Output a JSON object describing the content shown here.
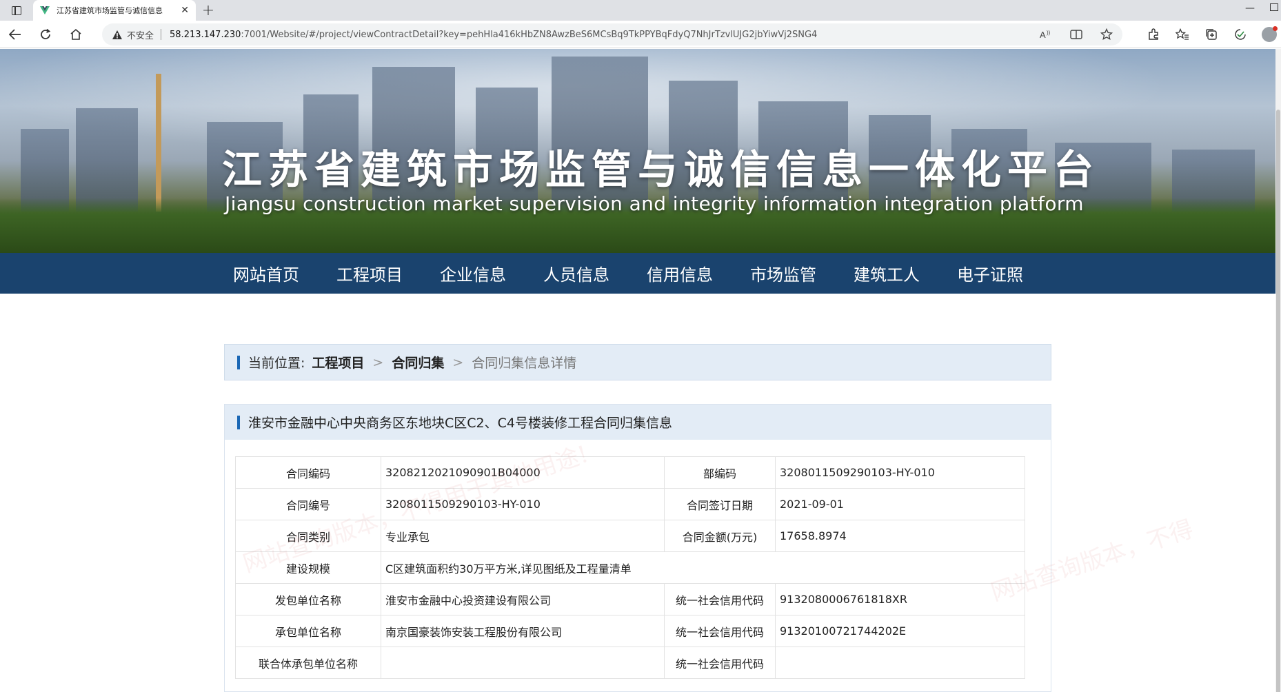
{
  "browser": {
    "tab_title": "江苏省建筑市场监管与诚信信息",
    "insecure_label": "不安全",
    "url_host": "58.213.147.230",
    "url_rest": ":7001/Website/#/project/viewContractDetail?key=pehHla416kHbZN8AwzBeS6MCsBq9TkPPYBqFdyQ7NhJrTzvlUJG2jbYiwVj2SNG4"
  },
  "banner": {
    "title": "江苏省建筑市场监管与诚信信息一体化平台",
    "subtitle": "Jiangsu construction market supervision and integrity information integration platform"
  },
  "nav": {
    "items": [
      {
        "label": "网站首页"
      },
      {
        "label": "工程项目"
      },
      {
        "label": "企业信息"
      },
      {
        "label": "人员信息"
      },
      {
        "label": "信用信息"
      },
      {
        "label": "市场监管"
      },
      {
        "label": "建筑工人"
      },
      {
        "label": "电子证照"
      }
    ]
  },
  "breadcrumb": {
    "label": "当前位置:",
    "level1": "工程项目",
    "sep": ">",
    "level2": "合同归集",
    "current": "合同归集信息详情"
  },
  "card": {
    "title": "淮安市金融中心中央商务区东地块C区C2、C4号楼装修工程合同归集信息"
  },
  "contract": {
    "rows": [
      {
        "l1": "合同编码",
        "v1": "3208212021090901B04000",
        "l2": "部编码",
        "v2": "3208011509290103-HY-010"
      },
      {
        "l1": "合同编号",
        "v1": "3208011509290103-HY-010",
        "l2": "合同签订日期",
        "v2": "2021-09-01"
      },
      {
        "l1": "合同类别",
        "v1": "专业承包",
        "l2": "合同金额(万元)",
        "v2": "17658.8974"
      },
      {
        "l1": "建设规模",
        "v1": "C区建筑面积约30万平方米,详见图纸及工程量清单"
      },
      {
        "l1": "发包单位名称",
        "v1": "淮安市金融中心投资建设有限公司",
        "l2": "统一社会信用代码",
        "v2": "9132080006761818XR"
      },
      {
        "l1": "承包单位名称",
        "v1": "南京国豪装饰安装工程股份有限公司",
        "l2": "统一社会信用代码",
        "v2": "91320100721744202E"
      },
      {
        "l1": "联合体承包单位名称",
        "v1": "",
        "l2": "统一社会信用代码",
        "v2": ""
      }
    ]
  },
  "watermark": {
    "text1": "网站查询版本，不得用于其他用途!",
    "text2": "网站查询版本，不得"
  },
  "colors": {
    "nav_bg": "#1a436e",
    "accent_bar": "#1a67b5",
    "panel_bg": "#e3ecf6"
  }
}
